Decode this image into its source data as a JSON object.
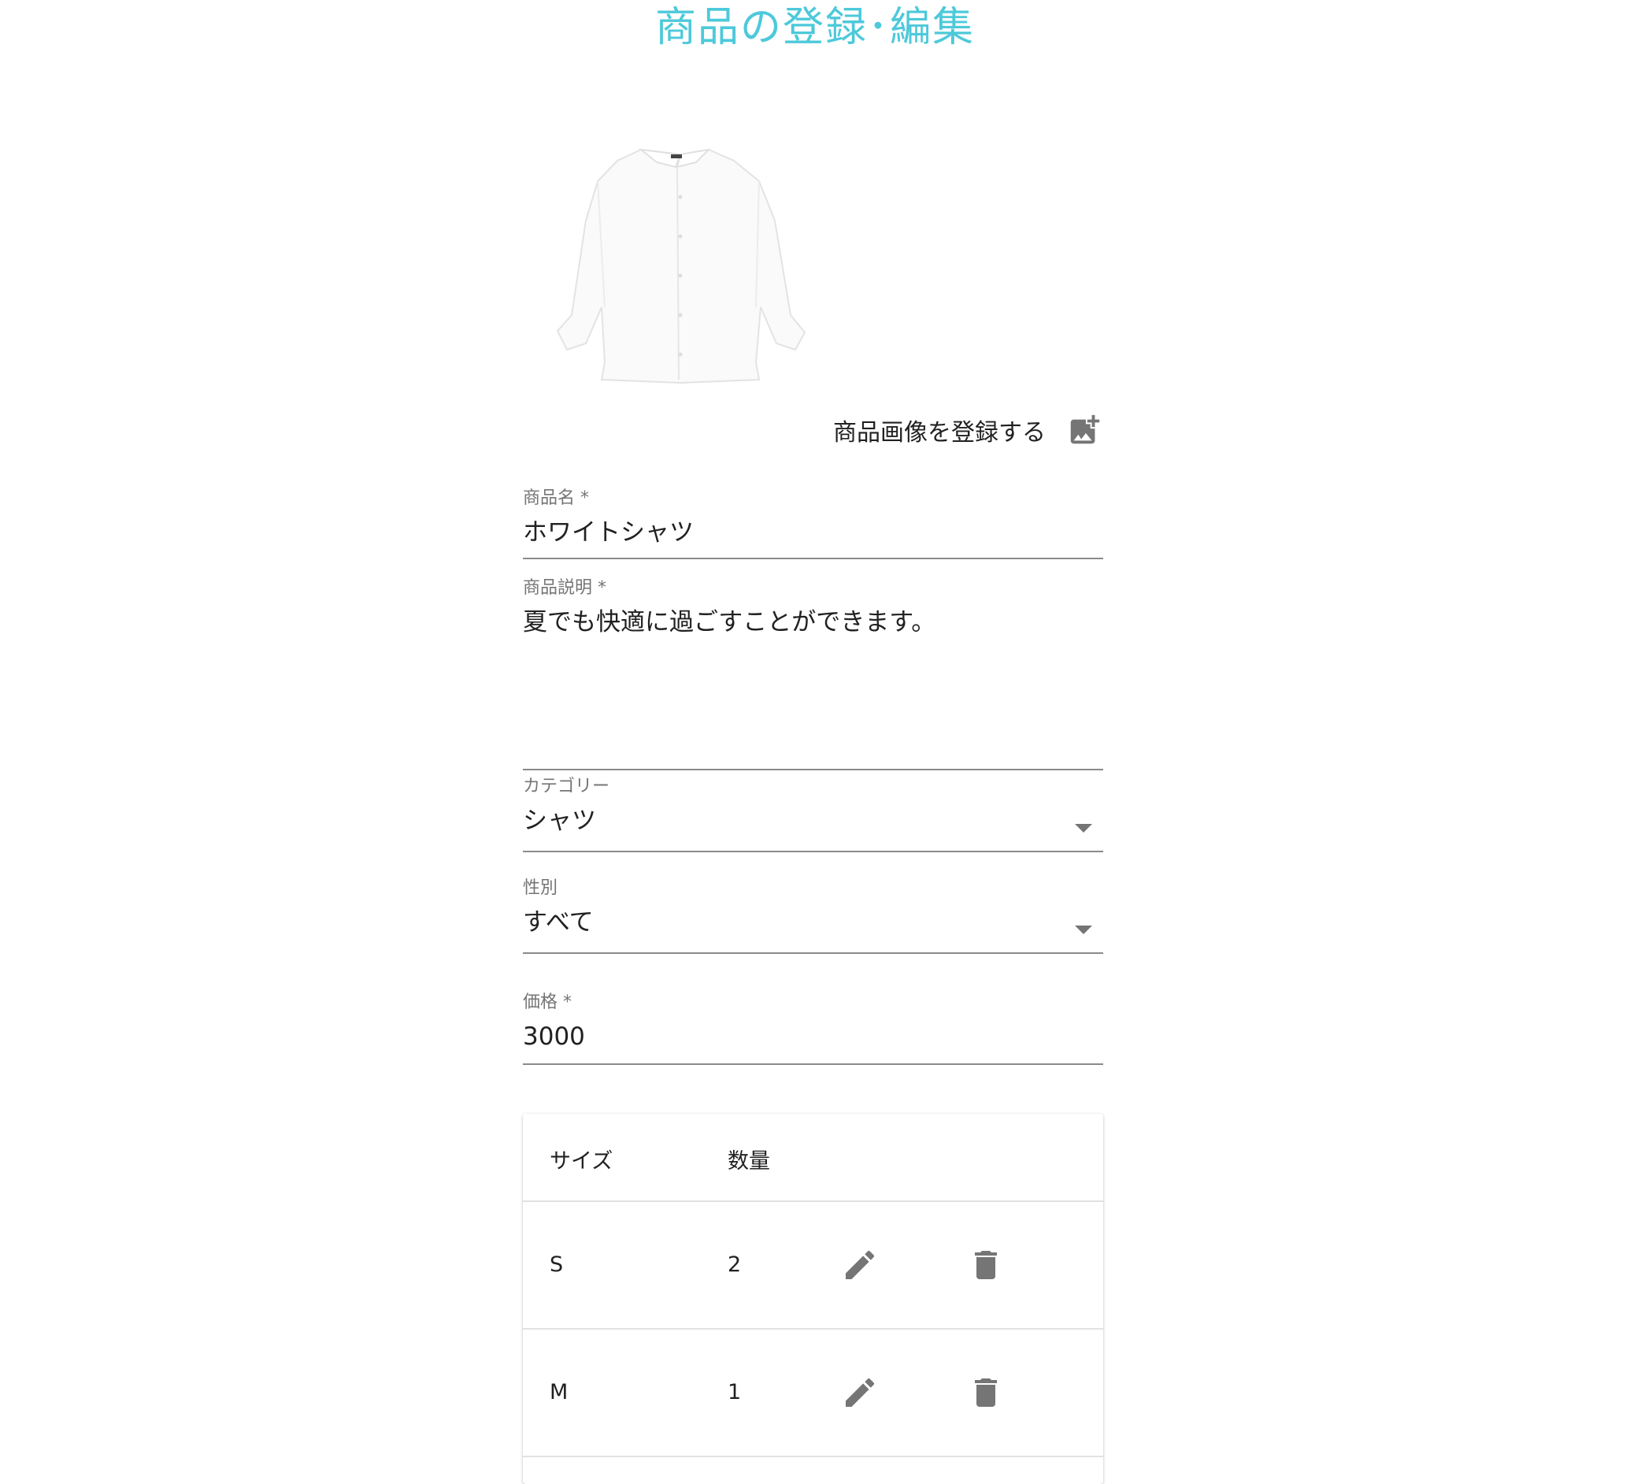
{
  "page": {
    "title": "商品の登録･編集"
  },
  "image_upload": {
    "label": "商品画像を登録する",
    "icon": "add-photo-icon"
  },
  "form": {
    "name": {
      "label": "商品名 *",
      "value": "ホワイトシャツ"
    },
    "description": {
      "label": "商品説明 *",
      "value": "夏でも快適に過ごすことができます。"
    },
    "category": {
      "label": "カテゴリー",
      "value": "シャツ"
    },
    "gender": {
      "label": "性別",
      "value": "すべて"
    },
    "price": {
      "label": "価格 *",
      "value": "3000"
    }
  },
  "size_table": {
    "headers": {
      "size": "サイズ",
      "quantity": "数量"
    },
    "rows": [
      {
        "size": "S",
        "quantity": "2"
      },
      {
        "size": "M",
        "quantity": "1"
      }
    ]
  },
  "colors": {
    "title": "#4dc9da",
    "icon": "#757575"
  }
}
